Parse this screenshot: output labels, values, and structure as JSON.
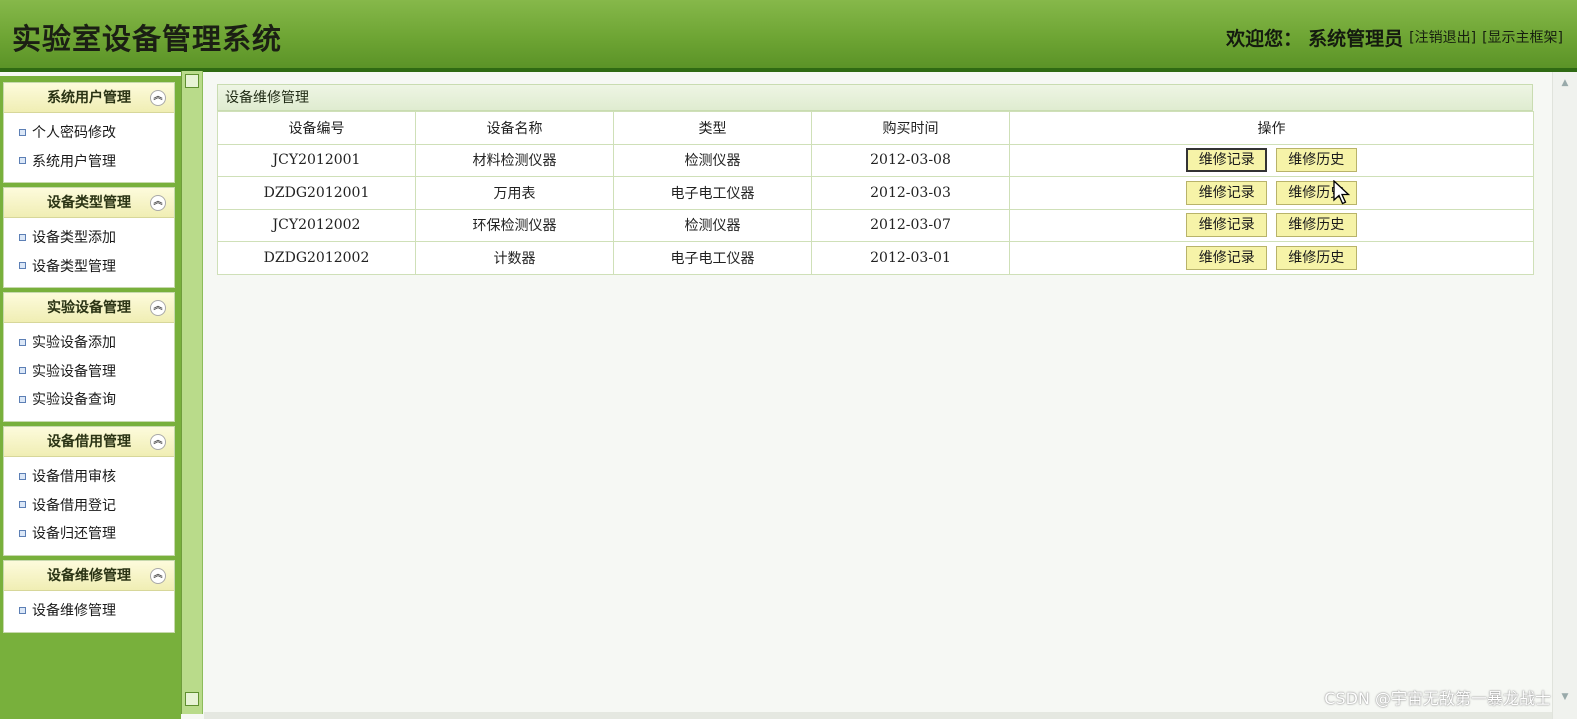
{
  "header": {
    "title": "实验室设备管理系统",
    "welcome_label": "欢迎您：",
    "user_name": "系统管理员",
    "logout_link": "[注销退出]",
    "show_frame_link": "[显示主框架]"
  },
  "sidebar": {
    "groups": [
      {
        "title": "系统用户管理",
        "items": [
          "个人密码修改",
          "系统用户管理"
        ]
      },
      {
        "title": "设备类型管理",
        "items": [
          "设备类型添加",
          "设备类型管理"
        ]
      },
      {
        "title": "实验设备管理",
        "items": [
          "实验设备添加",
          "实验设备管理",
          "实验设备查询"
        ]
      },
      {
        "title": "设备借用管理",
        "items": [
          "设备借用审核",
          "设备借用登记",
          "设备归还管理"
        ]
      },
      {
        "title": "设备维修管理",
        "items": [
          "设备维修管理"
        ]
      }
    ]
  },
  "main": {
    "panel_title": "设备维修管理",
    "columns": [
      "设备编号",
      "设备名称",
      "类型",
      "购买时间",
      "操作"
    ],
    "rows": [
      {
        "code": "JCY2012001",
        "name": "材料检测仪器",
        "type": "检测仪器",
        "date": "2012-03-08"
      },
      {
        "code": "DZDG2012001",
        "name": "万用表",
        "type": "电子电工仪器",
        "date": "2012-03-03"
      },
      {
        "code": "JCY2012002",
        "name": "环保检测仪器",
        "type": "检测仪器",
        "date": "2012-03-07"
      },
      {
        "code": "DZDG2012002",
        "name": "计数器",
        "type": "电子电工仪器",
        "date": "2012-03-01"
      }
    ],
    "action_record": "维修记录",
    "action_history": "维修历史"
  },
  "watermark": "CSDN @宇宙无敌第一暴龙战士",
  "icons": {
    "collapse": "double-chevron-up-icon",
    "bullet": "square-bullet-icon",
    "pointer": "mouse-pointer-icon"
  },
  "colors": {
    "header_green": "#6ea534",
    "sidebar_green": "#78b03c",
    "button_yellow": "#f6f3a8"
  }
}
